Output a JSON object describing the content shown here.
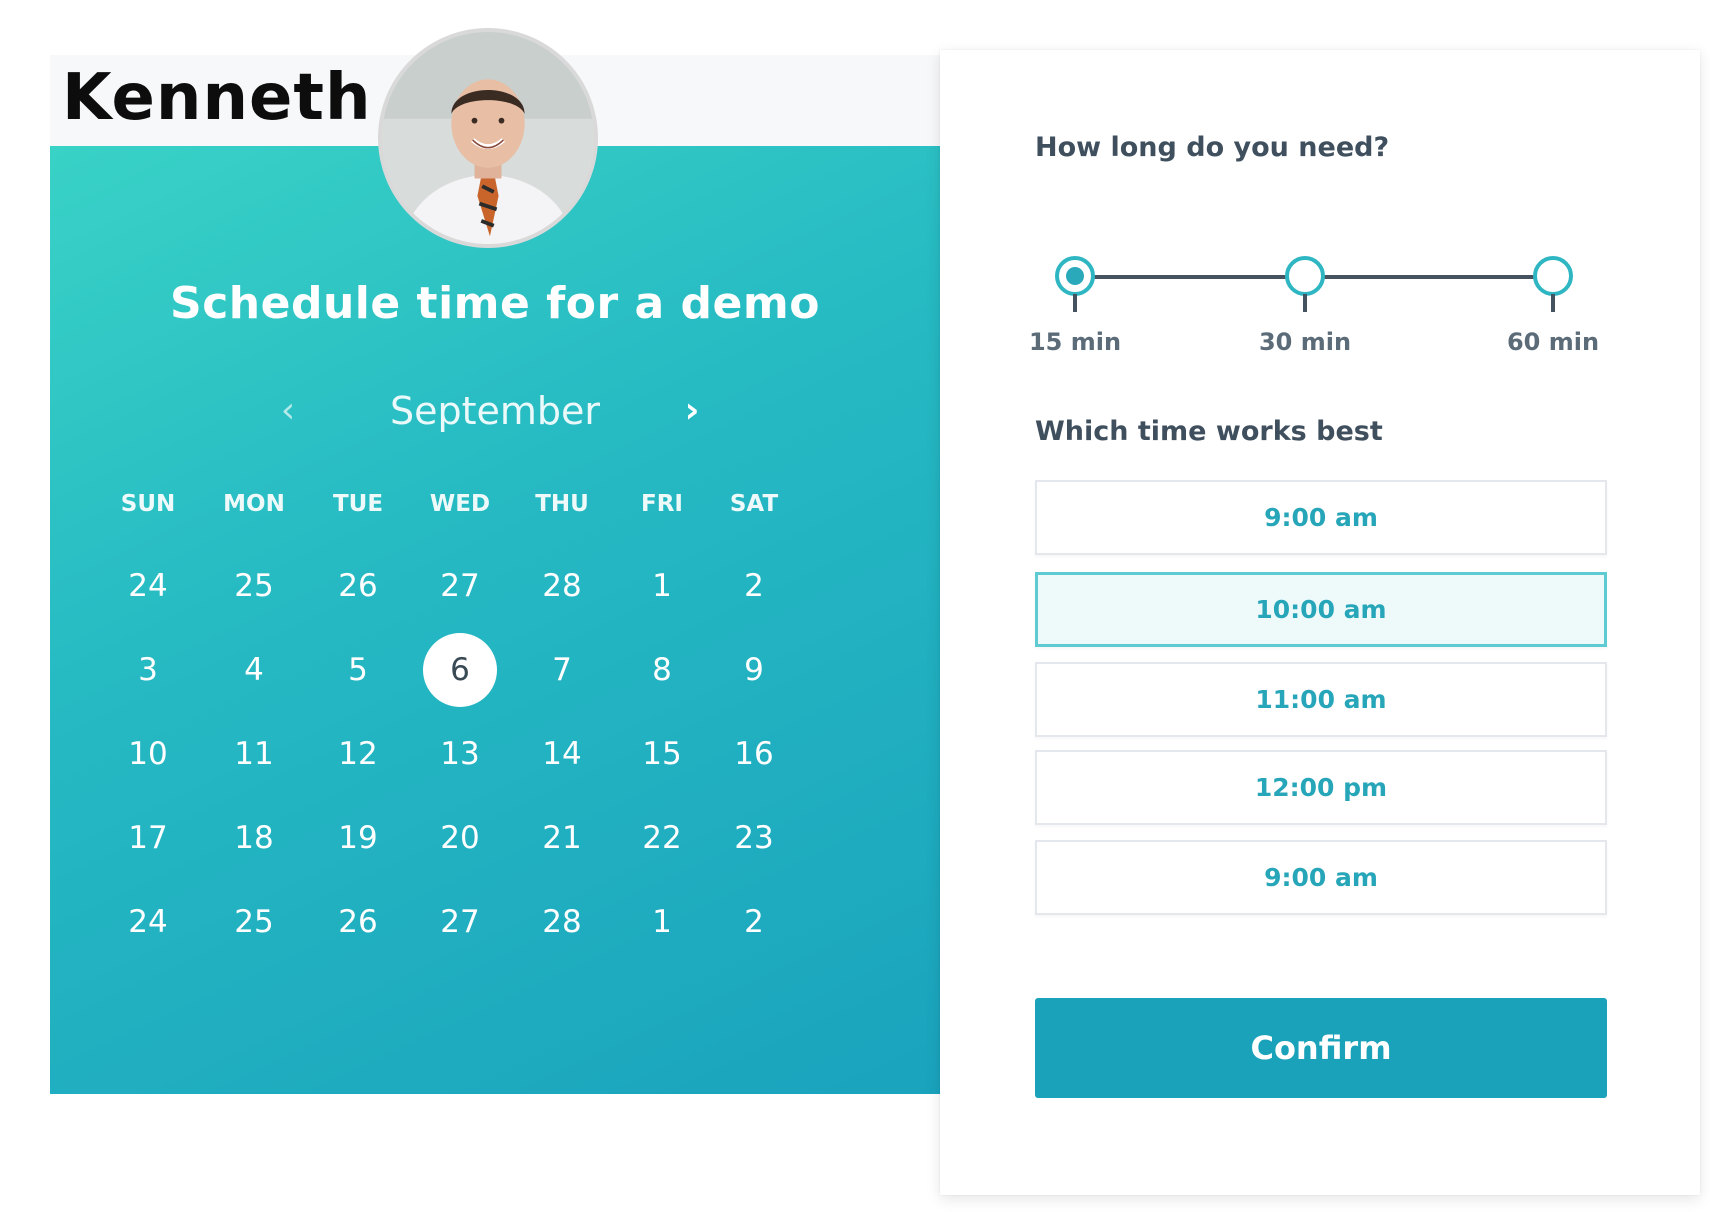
{
  "host": {
    "name": "Kenneth"
  },
  "calendar": {
    "title": "Schedule time for a demo",
    "month": "September",
    "prev_icon": "chevron-left-icon",
    "next_icon": "chevron-right-icon",
    "day_names": [
      "SUN",
      "MON",
      "TUE",
      "WED",
      "THU",
      "FRI",
      "SAT"
    ],
    "weeks": [
      [
        "24",
        "25",
        "26",
        "27",
        "28",
        "1",
        "2"
      ],
      [
        "3",
        "4",
        "5",
        "6",
        "7",
        "8",
        "9"
      ],
      [
        "10",
        "11",
        "12",
        "13",
        "14",
        "15",
        "16"
      ],
      [
        "17",
        "18",
        "19",
        "20",
        "21",
        "22",
        "23"
      ],
      [
        "24",
        "25",
        "26",
        "27",
        "28",
        "1",
        "2"
      ]
    ],
    "selected_day": "6"
  },
  "duration": {
    "title": "How long do you need?",
    "options": [
      "15 min",
      "30 min",
      "60 min"
    ],
    "selected": "15 min"
  },
  "times": {
    "title": "Which time works best",
    "slots": [
      "9:00 am",
      "10:00 am",
      "11:00 am",
      "12:00 pm",
      "9:00 am"
    ],
    "selected_index": 1
  },
  "confirm_label": "Confirm",
  "colors": {
    "accent": "#1aa2ba",
    "gradient_start": "#39d2c6",
    "gradient_end": "#1aa3bd",
    "heading_text": "#3f4f5d"
  }
}
